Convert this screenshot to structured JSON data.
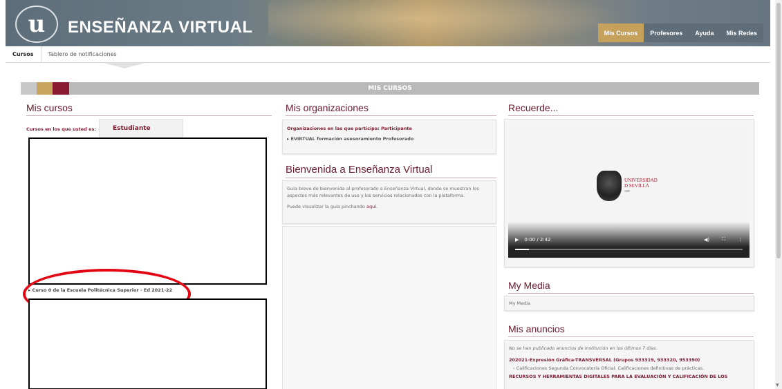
{
  "header": {
    "logo_letter": "u",
    "site_title": "ENSEÑANZA VIRTUAL",
    "nav": [
      "Mis Cursos",
      "Profesores",
      "Ayuda",
      "Mis Redes"
    ]
  },
  "subtabs": [
    "Cursos",
    "Tablero de notificaciones"
  ],
  "section_bar": {
    "label": "MIS CURSOS"
  },
  "mis_cursos": {
    "title": "Mis cursos",
    "role_prefix": "Cursos en los que usted es: ",
    "role_value": "Estudiante",
    "course_item": "Curso 0 de la Escuela Politécnica Superior - Ed 2021-22"
  },
  "mis_organizaciones": {
    "title": "Mis organizaciones",
    "subtitle": "Organizaciones en las que participa: Participante",
    "item": "EVIRTUAL formación asesoramiento Profesorado"
  },
  "bienvenida": {
    "title": "Bienvenida a Enseñanza Virtual",
    "text1": "Guía breve de bienvenida al profesorado a Enseñanza Virtual, donde se muestran los aspectos más relevantes de uso y los servicios relacionados con la plataforma.",
    "text2_prefix": "Puede visualizar la guía pinchando ",
    "text2_link": "aquí",
    "text2_suffix": "."
  },
  "recuerde": {
    "title": "Recuerde...",
    "video_logo_line1": "UNIVERSIDAD",
    "video_logo_line2": "D SEVILLA",
    "video_logo_year": "1505",
    "time": "0:00 / 2:42",
    "progress": 0.06
  },
  "my_media": {
    "title": "My Media",
    "link": "My Media"
  },
  "mis_anuncios": {
    "title": "Mis anuncios",
    "notice": "No se han publicado anuncios de institución en los últimos 7 días.",
    "course1": "202021-Expresión Gráfica-TRANSVERSAL (Grupos 933319, 933320, 953390)",
    "item1": "Calificaciones Segunda Convocatoria Oficial. Calificaciones definitivas de prácticas.",
    "course2": "RECURSOS Y HERRAMIENTAS DIGITALES PARA LA EVALUACIÓN Y CALIFICACIÓN DE LOS"
  }
}
